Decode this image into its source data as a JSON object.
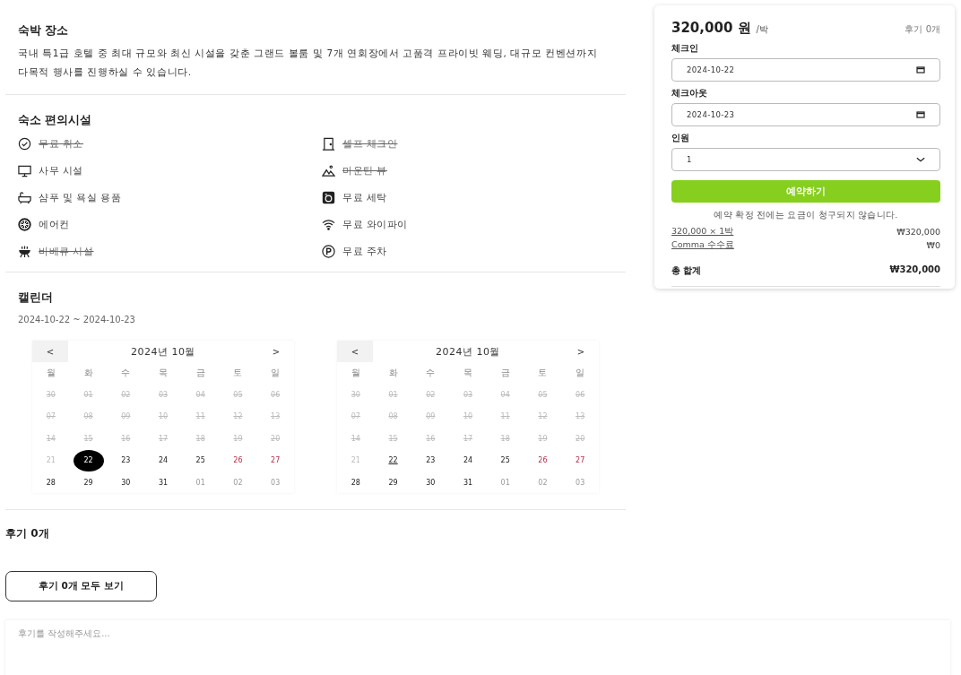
{
  "place": {
    "title": "숙박 장소",
    "description": "국내 특1급 호텔 중 최대 규모와 최신 시설을 갖춘 그랜드 볼룸 및 7개 연회장에서 고품격 프라이빗 웨딩, 대규모 컨벤션까지 다목적 행사를 진행하실 수 있습니다."
  },
  "amenities": {
    "title": "숙소 편의시설",
    "items": [
      {
        "label": "무료 취소",
        "available": false
      },
      {
        "label": "셀프 체크인",
        "available": false
      },
      {
        "label": "사무 시설",
        "available": true
      },
      {
        "label": "마운틴 뷰",
        "available": false
      },
      {
        "label": "샴푸 및 욕실 용품",
        "available": true
      },
      {
        "label": "무료 세탁",
        "available": true
      },
      {
        "label": "에어컨",
        "available": true
      },
      {
        "label": "무료 와이파이",
        "available": true
      },
      {
        "label": "바베큐 시설",
        "available": false
      },
      {
        "label": "무료 주차",
        "available": true
      }
    ]
  },
  "calendar": {
    "title": "캘린더",
    "range": "2024-10-22 ~ 2024-10-23",
    "prev": "<",
    "next": ">",
    "months": [
      {
        "title": "2024년 10월",
        "weekdays": [
          "월",
          "화",
          "수",
          "목",
          "금",
          "토",
          "일"
        ],
        "days": [
          {
            "d": "30",
            "kind": "past",
            "selected": false
          },
          {
            "d": "01",
            "kind": "past",
            "selected": false
          },
          {
            "d": "02",
            "kind": "past",
            "selected": false
          },
          {
            "d": "03",
            "kind": "past",
            "selected": false
          },
          {
            "d": "04",
            "kind": "past",
            "selected": false
          },
          {
            "d": "05",
            "kind": "past",
            "selected": false
          },
          {
            "d": "06",
            "kind": "past",
            "selected": false
          },
          {
            "d": "07",
            "kind": "past",
            "selected": false
          },
          {
            "d": "08",
            "kind": "past",
            "selected": false
          },
          {
            "d": "09",
            "kind": "past",
            "selected": false
          },
          {
            "d": "10",
            "kind": "past",
            "selected": false
          },
          {
            "d": "11",
            "kind": "past",
            "selected": false
          },
          {
            "d": "12",
            "kind": "past",
            "selected": false
          },
          {
            "d": "13",
            "kind": "past",
            "selected": false
          },
          {
            "d": "14",
            "kind": "past",
            "selected": false
          },
          {
            "d": "15",
            "kind": "past",
            "selected": false
          },
          {
            "d": "16",
            "kind": "past",
            "selected": false
          },
          {
            "d": "17",
            "kind": "past",
            "selected": false
          },
          {
            "d": "18",
            "kind": "past",
            "selected": false
          },
          {
            "d": "19",
            "kind": "past",
            "selected": false
          },
          {
            "d": "20",
            "kind": "past",
            "selected": false
          },
          {
            "d": "21",
            "kind": "faded",
            "selected": false
          },
          {
            "d": "22",
            "kind": "normal",
            "selected": true
          },
          {
            "d": "23",
            "kind": "normal",
            "selected": false
          },
          {
            "d": "24",
            "kind": "normal",
            "selected": false
          },
          {
            "d": "25",
            "kind": "normal",
            "selected": false
          },
          {
            "d": "26",
            "kind": "weekend",
            "selected": false
          },
          {
            "d": "27",
            "kind": "weekend",
            "selected": false
          },
          {
            "d": "28",
            "kind": "normal",
            "selected": false
          },
          {
            "d": "29",
            "kind": "normal",
            "selected": false
          },
          {
            "d": "30",
            "kind": "normal",
            "selected": false
          },
          {
            "d": "31",
            "kind": "normal",
            "selected": false
          },
          {
            "d": "01",
            "kind": "outside",
            "selected": false
          },
          {
            "d": "02",
            "kind": "outside",
            "selected": false
          },
          {
            "d": "03",
            "kind": "outside",
            "selected": false
          }
        ]
      },
      {
        "title": "2024년 10월",
        "weekdays": [
          "월",
          "화",
          "수",
          "목",
          "금",
          "토",
          "일"
        ],
        "days": [
          {
            "d": "30",
            "kind": "past",
            "selected": false
          },
          {
            "d": "01",
            "kind": "past",
            "selected": false
          },
          {
            "d": "02",
            "kind": "past",
            "selected": false
          },
          {
            "d": "03",
            "kind": "past",
            "selected": false
          },
          {
            "d": "04",
            "kind": "past",
            "selected": false
          },
          {
            "d": "05",
            "kind": "past",
            "selected": false
          },
          {
            "d": "06",
            "kind": "past",
            "selected": false
          },
          {
            "d": "07",
            "kind": "past",
            "selected": false
          },
          {
            "d": "08",
            "kind": "past",
            "selected": false
          },
          {
            "d": "09",
            "kind": "past",
            "selected": false
          },
          {
            "d": "10",
            "kind": "past",
            "selected": false
          },
          {
            "d": "11",
            "kind": "past",
            "selected": false
          },
          {
            "d": "12",
            "kind": "past",
            "selected": false
          },
          {
            "d": "13",
            "kind": "past",
            "selected": false
          },
          {
            "d": "14",
            "kind": "past",
            "selected": false
          },
          {
            "d": "15",
            "kind": "past",
            "selected": false
          },
          {
            "d": "16",
            "kind": "past",
            "selected": false
          },
          {
            "d": "17",
            "kind": "past",
            "selected": false
          },
          {
            "d": "18",
            "kind": "past",
            "selected": false
          },
          {
            "d": "19",
            "kind": "past",
            "selected": false
          },
          {
            "d": "20",
            "kind": "past",
            "selected": false
          },
          {
            "d": "21",
            "kind": "faded",
            "selected": false
          },
          {
            "d": "22",
            "kind": "today",
            "selected": false
          },
          {
            "d": "23",
            "kind": "normal",
            "selected": false
          },
          {
            "d": "24",
            "kind": "normal",
            "selected": false
          },
          {
            "d": "25",
            "kind": "normal",
            "selected": false
          },
          {
            "d": "26",
            "kind": "weekend",
            "selected": false
          },
          {
            "d": "27",
            "kind": "weekend",
            "selected": false
          },
          {
            "d": "28",
            "kind": "normal",
            "selected": false
          },
          {
            "d": "29",
            "kind": "normal",
            "selected": false
          },
          {
            "d": "30",
            "kind": "normal",
            "selected": false
          },
          {
            "d": "31",
            "kind": "normal",
            "selected": false
          },
          {
            "d": "01",
            "kind": "outside",
            "selected": false
          },
          {
            "d": "02",
            "kind": "outside",
            "selected": false
          },
          {
            "d": "03",
            "kind": "outside",
            "selected": false
          }
        ]
      }
    ]
  },
  "reviews": {
    "title": "후기 0개",
    "show_all": "후기 0개 모두 보기",
    "placeholder": "후기를 작성해주세요..."
  },
  "booking": {
    "price": "320,000 원",
    "unit": "/박",
    "review_count": "후기 0개",
    "fields": [
      {
        "label": "체크인",
        "kind": "date",
        "value": "2024-10-22"
      },
      {
        "label": "체크아웃",
        "kind": "date",
        "value": "2024-10-23"
      },
      {
        "label": "인원",
        "kind": "select",
        "value": "1"
      }
    ],
    "reserve": "예약하기",
    "note": "예약 확정 전에는 요금이 청구되지 않습니다.",
    "lines": [
      {
        "label": "320,000 × 1박",
        "amount": "₩320,000"
      },
      {
        "label": "Comma 수수료",
        "amount": "₩0"
      }
    ],
    "total_label": "총 합계",
    "total": "₩320,000"
  }
}
